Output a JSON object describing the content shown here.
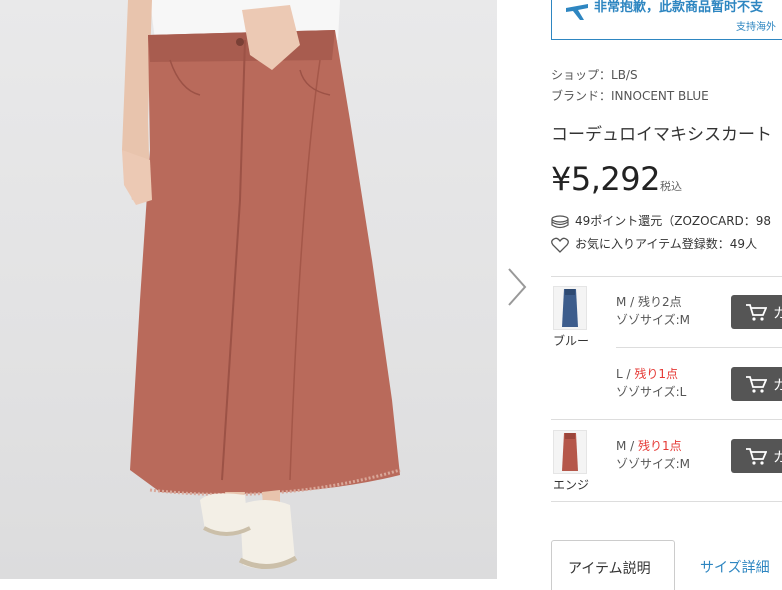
{
  "notice": {
    "main": "非常抱歉，此款商品暂时不支",
    "sub": "支持海外",
    "icon": "plane-icon",
    "color": "#2e86c1"
  },
  "shop": {
    "label": "ショップ：",
    "value": "LB/S"
  },
  "brand": {
    "label": "ブランド：",
    "value": "INNOCENT BLUE"
  },
  "product": {
    "title": "コーデュロイマキシスカート",
    "price": "¥5,292",
    "tax": "税込"
  },
  "points": {
    "icon": "coin-stack-icon",
    "text": "49ポイント還元（ZOZOCARD：98"
  },
  "favorite": {
    "icon": "heart-icon",
    "text": "お気に入りアイテム登録数：49人"
  },
  "variants": [
    {
      "color_name": "ブルー",
      "size": "M",
      "slash": " / ",
      "stock": "残り2点",
      "stock_highlight": false,
      "zozo_size": "ゾゾサイズ:M",
      "swatch_color": "#3d5d8c"
    },
    {
      "color_name": "",
      "size": "L",
      "slash": " / ",
      "stock": "残り1点",
      "stock_highlight": true,
      "zozo_size": "ゾゾサイズ:L"
    },
    {
      "color_name": "エンジ",
      "size": "M",
      "slash": " / ",
      "stock": "残り1点",
      "stock_highlight": true,
      "zozo_size": "ゾゾサイズ:M",
      "swatch_color": "#b5574a"
    }
  ],
  "cart": {
    "icon": "cart-icon",
    "label": "カ"
  },
  "tabs": {
    "description": "アイテム説明",
    "size_detail": "サイズ詳細"
  },
  "colors": {
    "accent": "#2e86c1",
    "stock_red": "#e53935",
    "cart_bg": "#555555",
    "skirt": "#b96a5b"
  }
}
